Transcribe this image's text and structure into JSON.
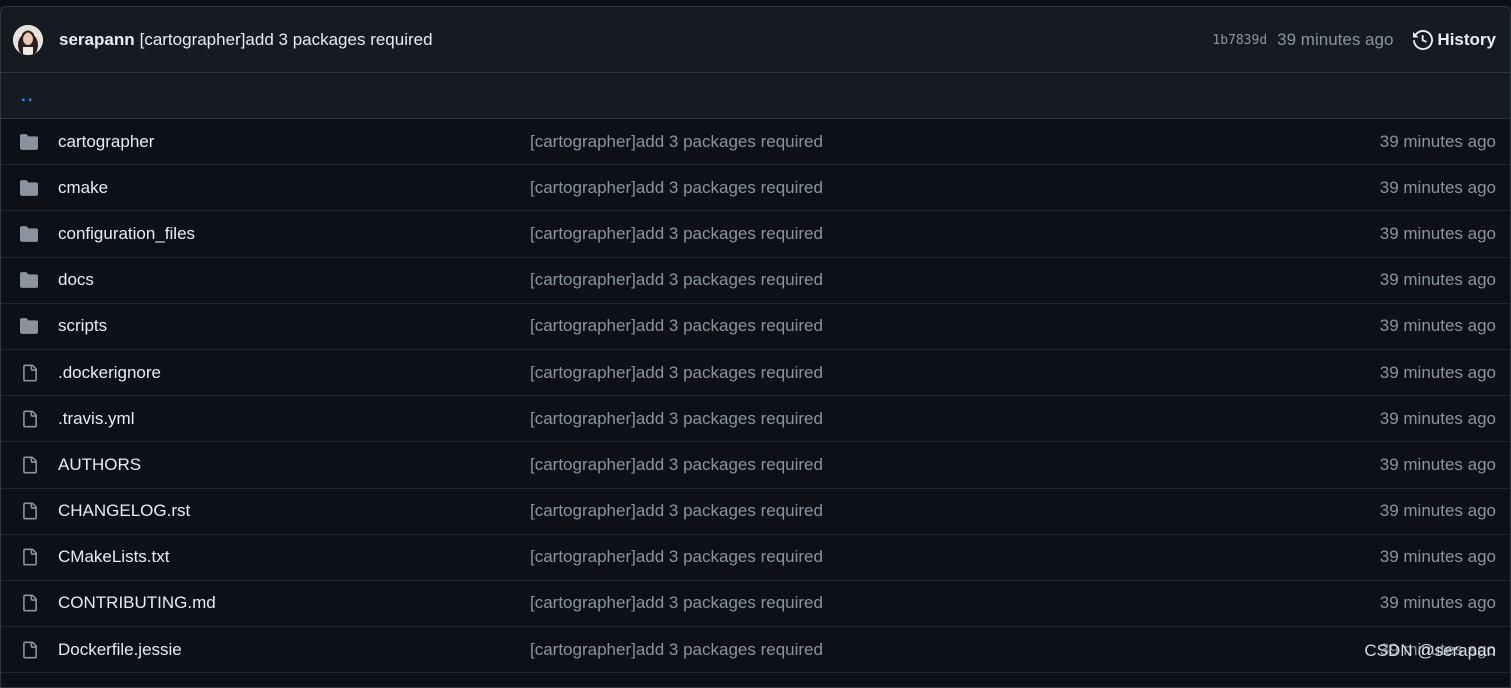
{
  "commit": {
    "author": "serapann",
    "message": "[cartographer]add 3 packages required",
    "sha": "1b7839d",
    "time": "39 minutes ago",
    "history_label": "History"
  },
  "parent_dir_label": "..",
  "files": [
    {
      "name": "cartographer",
      "type": "folder",
      "commit": "[cartographer]add 3 packages required",
      "time": "39 minutes ago"
    },
    {
      "name": "cmake",
      "type": "folder",
      "commit": "[cartographer]add 3 packages required",
      "time": "39 minutes ago"
    },
    {
      "name": "configuration_files",
      "type": "folder",
      "commit": "[cartographer]add 3 packages required",
      "time": "39 minutes ago"
    },
    {
      "name": "docs",
      "type": "folder",
      "commit": "[cartographer]add 3 packages required",
      "time": "39 minutes ago"
    },
    {
      "name": "scripts",
      "type": "folder",
      "commit": "[cartographer]add 3 packages required",
      "time": "39 minutes ago"
    },
    {
      "name": ".dockerignore",
      "type": "file",
      "commit": "[cartographer]add 3 packages required",
      "time": "39 minutes ago"
    },
    {
      "name": ".travis.yml",
      "type": "file",
      "commit": "[cartographer]add 3 packages required",
      "time": "39 minutes ago"
    },
    {
      "name": "AUTHORS",
      "type": "file",
      "commit": "[cartographer]add 3 packages required",
      "time": "39 minutes ago"
    },
    {
      "name": "CHANGELOG.rst",
      "type": "file",
      "commit": "[cartographer]add 3 packages required",
      "time": "39 minutes ago"
    },
    {
      "name": "CMakeLists.txt",
      "type": "file",
      "commit": "[cartographer]add 3 packages required",
      "time": "39 minutes ago"
    },
    {
      "name": "CONTRIBUTING.md",
      "type": "file",
      "commit": "[cartographer]add 3 packages required",
      "time": "39 minutes ago"
    },
    {
      "name": "Dockerfile.jessie",
      "type": "file",
      "commit": "[cartographer]add 3 packages required",
      "time": "39 minutes ago"
    }
  ],
  "watermark": "CSDN @serapan",
  "icons": {
    "folder": "folder-icon",
    "file": "file-icon",
    "history": "history-icon"
  },
  "colors": {
    "background": "#0d1117",
    "header_background": "#161b22",
    "border": "#30363d",
    "text": "#e6edf3",
    "muted": "#8b949e",
    "link": "#2f81f7"
  }
}
